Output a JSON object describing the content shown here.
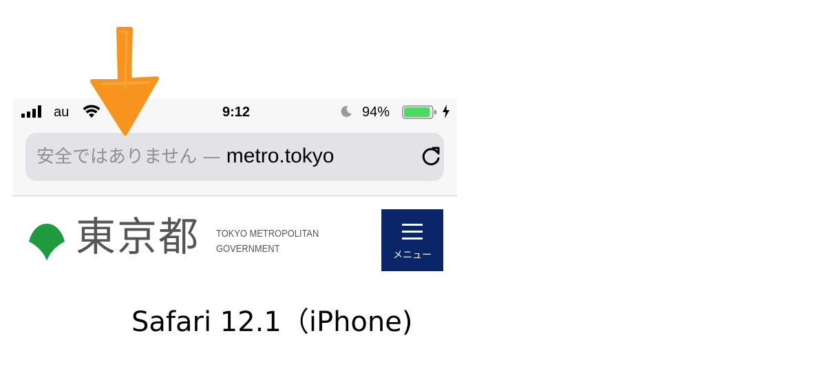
{
  "status_bar": {
    "carrier": "au",
    "time": "9:12",
    "battery_percent": "94%",
    "battery_level": 0.94,
    "icons": [
      "signal-bars-icon",
      "wifi-icon",
      "moon-icon",
      "battery-icon",
      "charging-bolt-icon"
    ]
  },
  "url_bar": {
    "security_warning": "安全ではありません — ",
    "domain": "metro.tokyo",
    "reload_icon": "reload-icon"
  },
  "site_header": {
    "logo_icon": "ginkgo-leaf-logo-icon",
    "logo_kanji": "東京都",
    "logo_english_line1": "TOKYO METROPOLITAN",
    "logo_english_line2": "GOVERNMENT",
    "menu_label": "メニュー",
    "menu_icon": "hamburger-icon"
  },
  "caption": "Safari 12.1（iPhone)",
  "annotation": {
    "icon": "down-arrow-icon"
  },
  "colors": {
    "chrome_background": "#f7f7f7",
    "url_bar_background": "#e3e3e7",
    "warning_text": "#8e8e93",
    "battery_green": "#4cd964",
    "logo_green": "#1e9b3c",
    "logo_text": "#555555",
    "menu_button": "#0b2569",
    "arrow_orange": "#f7941d"
  }
}
